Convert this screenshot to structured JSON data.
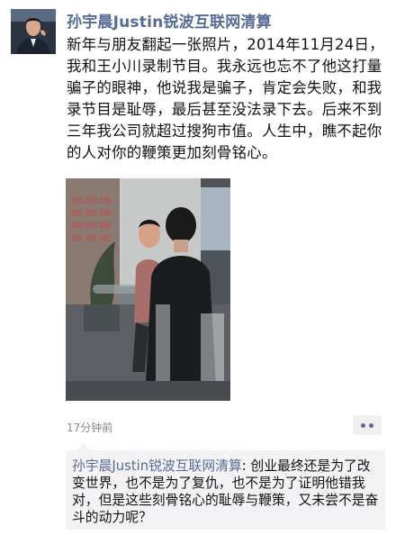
{
  "post": {
    "author": "孙宇晨Justin锐波互联网清算",
    "text": "新年与朋友翻起一张照片，2014年11月24日，我和王小川录制节目。我永远也忘不了他这打量骗子的眼神，他说我是骗子，肯定会失败，和我录节目是耻辱，最后甚至没法录下去。后来不到三年我公司就超过搜狗市值。人生中，瞧不起你的人对你的鞭策更加刻骨铭心。",
    "time": "17分钟前"
  },
  "comments": [
    {
      "author": "孙宇晨Justin锐波互联网清算",
      "separator": ": ",
      "text": "创业最终还是为了改变世界，也不是为了复仇，也不是为了证明他错我对，但是这些刻骨铭心的耻辱与鞭策，又未尝不是奋斗的动力呢？"
    }
  ],
  "icons": {
    "more": "more-dots-icon"
  },
  "colors": {
    "link": "#576b95",
    "text": "#111111",
    "time": "#888888",
    "comment_bg": "#f3f3f5"
  }
}
